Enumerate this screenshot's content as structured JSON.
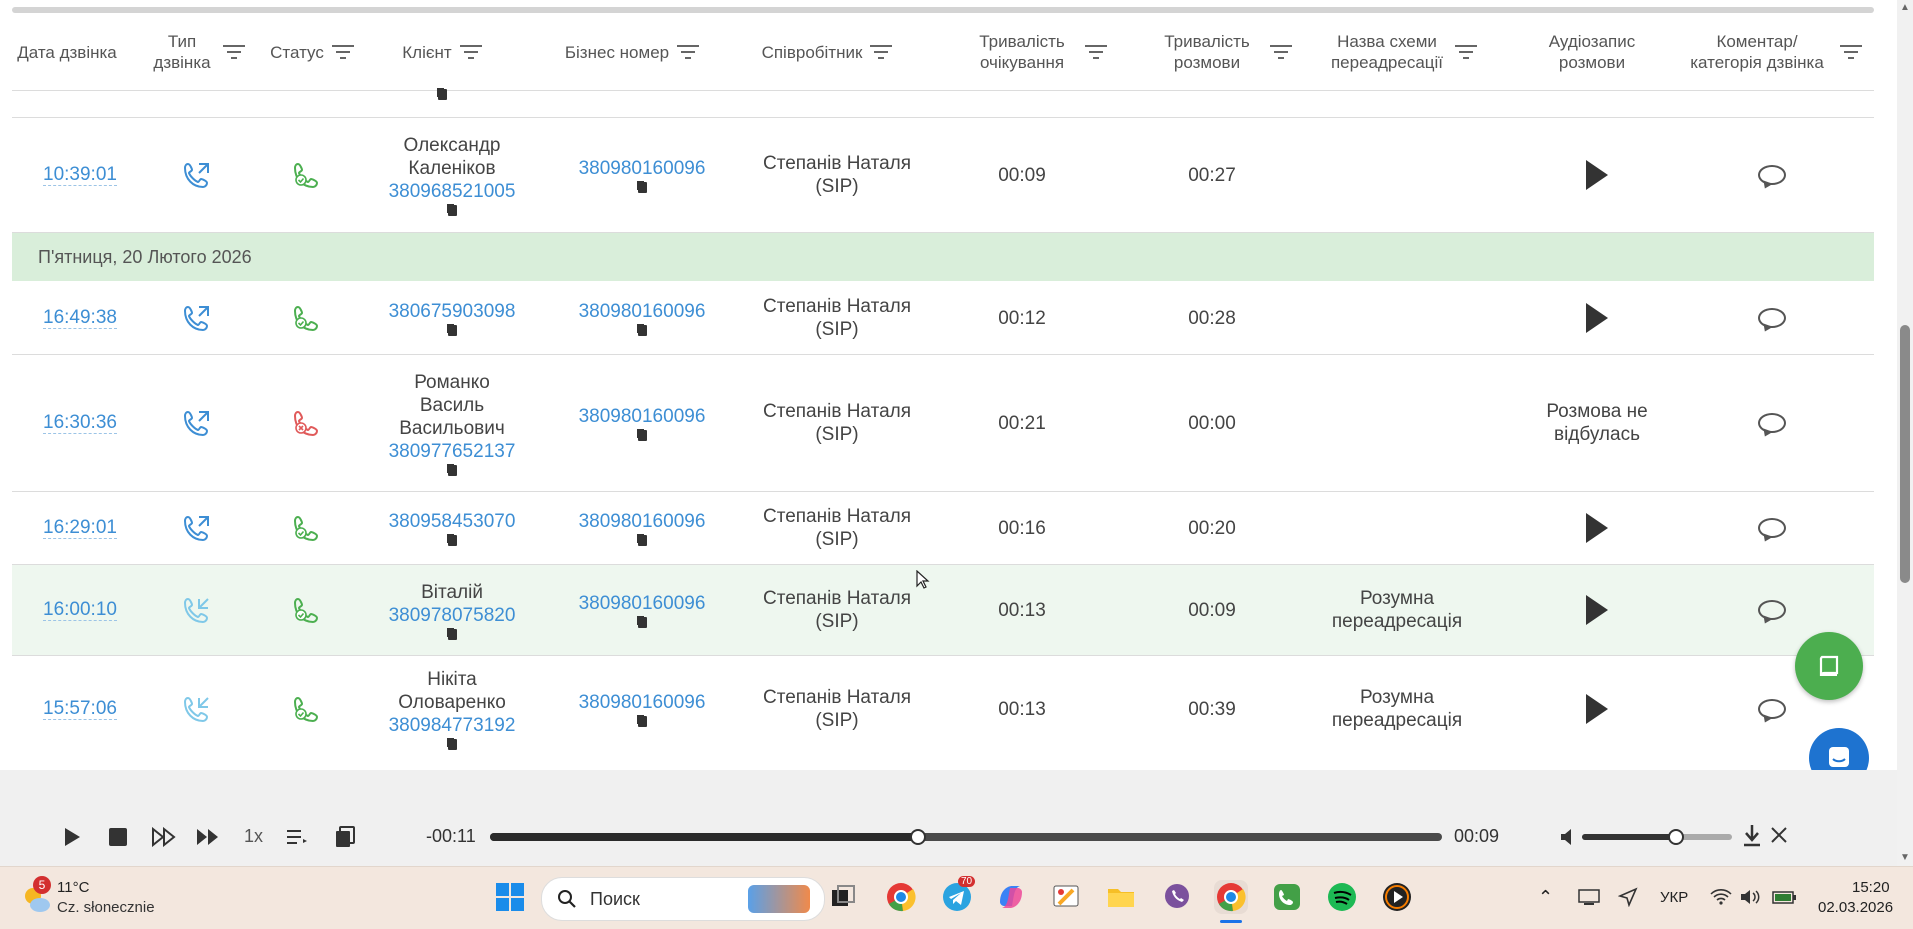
{
  "header": {
    "columns": [
      {
        "label": "Дата дзвінка"
      },
      {
        "label": "Тип дзвінка"
      },
      {
        "label": "Статус"
      },
      {
        "label": "Клієнт"
      },
      {
        "label": "Бізнес номер"
      },
      {
        "label": "Співробітник"
      },
      {
        "label": "Тривалість очікування"
      },
      {
        "label": "Тривалість розмови"
      },
      {
        "label": "Назва схеми переадресації"
      },
      {
        "label": "Аудіозапис розмови"
      },
      {
        "label": "Коментар/ категорія дзвінка"
      }
    ]
  },
  "group_date": "П'ятниця, 20 Лютого 2026",
  "rows": [
    {
      "time": "10:39:01",
      "direction": "outgoing",
      "status": "answered",
      "client_name": "Олександр Каленіков",
      "client_phone": "380968521005",
      "business": "380980160096",
      "employee": "Степанів Наталя (SIP)",
      "wait": "00:09",
      "talk": "00:27",
      "scheme": "",
      "audio": "play",
      "audio_text": ""
    },
    {
      "time": "16:49:38",
      "direction": "outgoing",
      "status": "answered",
      "client_name": "",
      "client_phone": "380675903098",
      "business": "380980160096",
      "employee": "Степанів Наталя (SIP)",
      "wait": "00:12",
      "talk": "00:28",
      "scheme": "",
      "audio": "play",
      "audio_text": ""
    },
    {
      "time": "16:30:36",
      "direction": "outgoing",
      "status": "missed",
      "client_name": "Романко Василь Васильович",
      "client_phone": "380977652137",
      "business": "380980160096",
      "employee": "Степанів Наталя (SIP)",
      "wait": "00:21",
      "talk": "00:00",
      "scheme": "",
      "audio": "none",
      "audio_text": "Розмова не відбулась"
    },
    {
      "time": "16:29:01",
      "direction": "outgoing",
      "status": "answered",
      "client_name": "",
      "client_phone": "380958453070",
      "business": "380980160096",
      "employee": "Степанів Наталя (SIP)",
      "wait": "00:16",
      "talk": "00:20",
      "scheme": "",
      "audio": "play",
      "audio_text": ""
    },
    {
      "time": "16:00:10",
      "direction": "incoming",
      "status": "answered",
      "client_name": "Віталій",
      "client_phone": "380978075820",
      "business": "380980160096",
      "employee": "Степанів Наталя (SIP)",
      "wait": "00:13",
      "talk": "00:09",
      "scheme": "Розумна переадресація",
      "audio": "play",
      "audio_text": ""
    },
    {
      "time": "15:57:06",
      "direction": "incoming",
      "status": "answered",
      "client_name": "Нікіта Оловаренко",
      "client_phone": "380984773192",
      "business": "380980160096",
      "employee": "Степанів Наталя (SIP)",
      "wait": "00:13",
      "talk": "00:39",
      "scheme": "Розумна переадресація",
      "audio": "play",
      "audio_text": ""
    }
  ],
  "player": {
    "speed": "1x",
    "remaining": "-00:11",
    "elapsed": "00:09",
    "progress_fraction": 0.45,
    "volume_fraction": 0.62
  },
  "taskbar": {
    "weather_badge": "5",
    "temperature": "11°C",
    "weather_desc": "Cz. słonecznie",
    "search_placeholder": "Поиск",
    "telegram_badge": "70",
    "language": "УКР",
    "time": "15:20",
    "date": "02.03.2026"
  },
  "colors": {
    "link": "#3d8ed4",
    "answered": "#4caf50",
    "missed": "#e05a5a",
    "incoming": "#7fc8e8",
    "group_bg": "#d9eeda",
    "fab": "#4cae4f"
  }
}
